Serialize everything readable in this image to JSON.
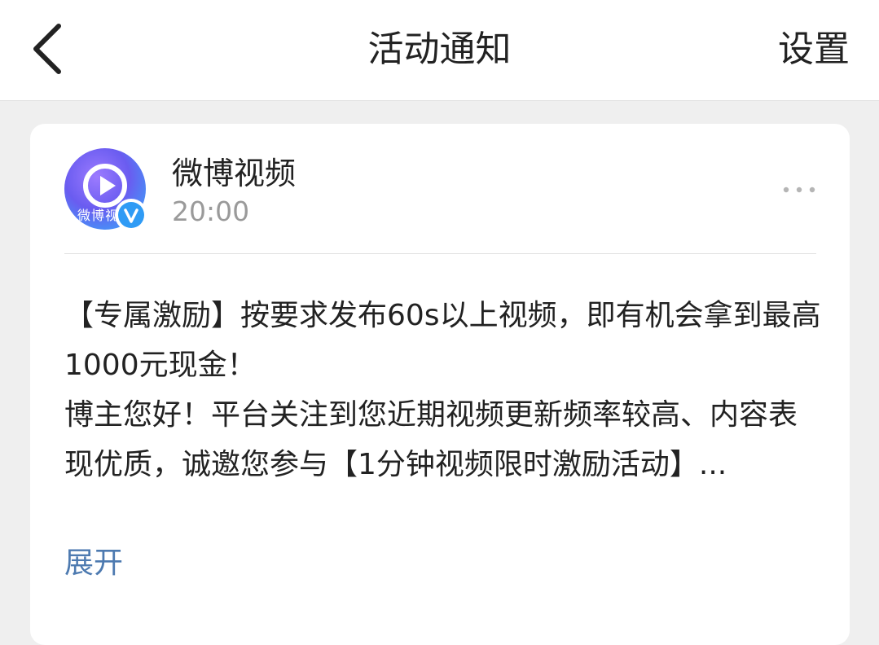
{
  "header": {
    "title": "活动通知",
    "settings_label": "设置"
  },
  "message": {
    "avatar_text": "微博视",
    "sender": "微博视频",
    "time": "20:00",
    "body": [
      "【专属激励】按要求发布60s以上视频，即有机会拿到最高1000元现金！",
      "博主您好！平台关注到您近期视频更新频率较高、内容表现优质，诚邀您参与【1分钟视频限时激励活动】..."
    ],
    "expand_label": "展开"
  },
  "colors": {
    "link": "#4d7ab0",
    "verified": "#2f9bf5"
  },
  "icons": {
    "back": "chevron-left-icon",
    "more": "more-horizontal-icon",
    "verified": "verified-badge-icon",
    "play": "play-icon"
  }
}
